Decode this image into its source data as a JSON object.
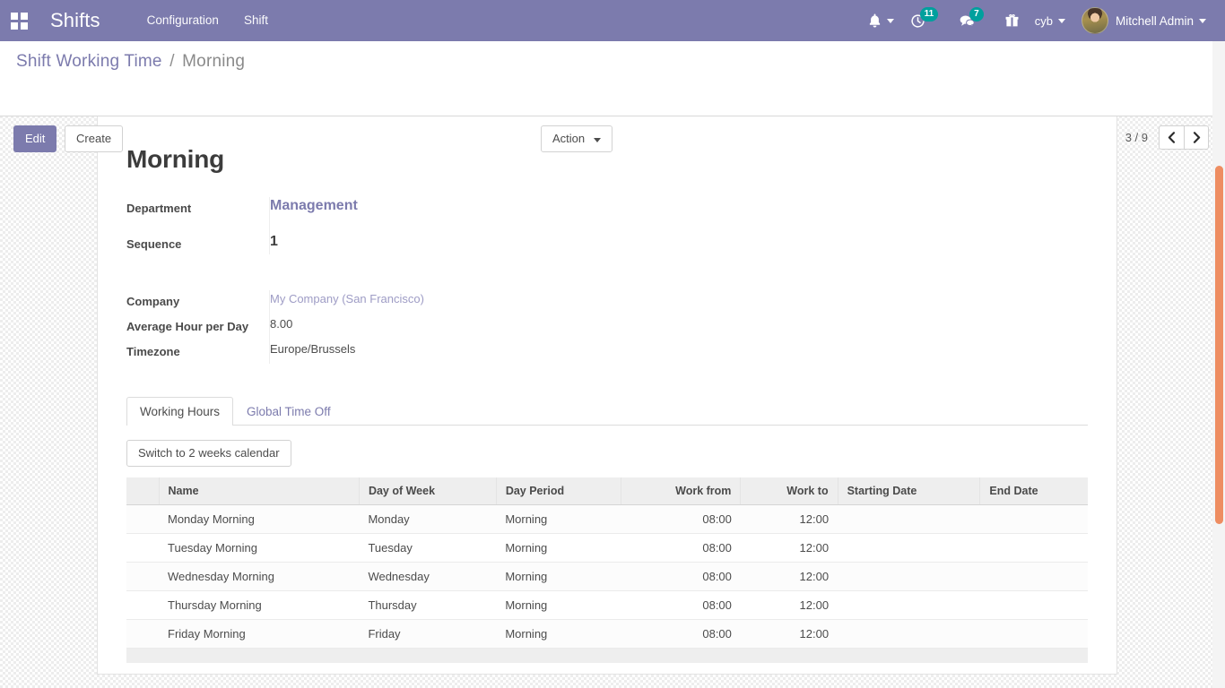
{
  "navbar": {
    "apps_icon": "apps-grid-icon",
    "brand": "Shifts",
    "menus": [
      {
        "label": "Configuration"
      },
      {
        "label": "Shift"
      }
    ],
    "activities_count": "11",
    "messages_count": "7",
    "database": "cyb",
    "user": "Mitchell Admin",
    "bg_color": "#7c7bad",
    "badge_color": "#00a09d"
  },
  "control_panel": {
    "breadcrumb_root": "Shift Working Time",
    "breadcrumb_separator": "/",
    "breadcrumb_current": "Morning",
    "edit_label": "Edit",
    "create_label": "Create",
    "action_label": "Action",
    "pager_text": "3 / 9",
    "pager_prev": "‹",
    "pager_next": "›"
  },
  "form": {
    "title": "Morning",
    "group_main": [
      {
        "label": "Department",
        "value": "Management",
        "kind": "link-strong"
      },
      {
        "label": "Sequence",
        "value": "1",
        "kind": "big"
      }
    ],
    "group_secondary": [
      {
        "label": "Company",
        "value": "My Company (San Francisco)",
        "kind": "link-soft"
      },
      {
        "label": "Average Hour per Day",
        "value": "8.00",
        "kind": "text"
      },
      {
        "label": "Timezone",
        "value": "Europe/Brussels",
        "kind": "text"
      }
    ]
  },
  "notebook": {
    "tabs": [
      {
        "label": "Working Hours",
        "active": true
      },
      {
        "label": "Global Time Off",
        "active": false
      }
    ],
    "switch_button": "Switch to 2 weeks calendar"
  },
  "working_hours_table": {
    "columns": [
      "Name",
      "Day of Week",
      "Day Period",
      "Work from",
      "Work to",
      "Starting Date",
      "End Date"
    ],
    "rows": [
      {
        "name": "Monday Morning",
        "day_of_week": "Monday",
        "day_period": "Morning",
        "work_from": "08:00",
        "work_to": "12:00",
        "starting_date": "",
        "end_date": ""
      },
      {
        "name": "Tuesday Morning",
        "day_of_week": "Tuesday",
        "day_period": "Morning",
        "work_from": "08:00",
        "work_to": "12:00",
        "starting_date": "",
        "end_date": ""
      },
      {
        "name": "Wednesday Morning",
        "day_of_week": "Wednesday",
        "day_period": "Morning",
        "work_from": "08:00",
        "work_to": "12:00",
        "starting_date": "",
        "end_date": ""
      },
      {
        "name": "Thursday Morning",
        "day_of_week": "Thursday",
        "day_period": "Morning",
        "work_from": "08:00",
        "work_to": "12:00",
        "starting_date": "",
        "end_date": ""
      },
      {
        "name": "Friday Morning",
        "day_of_week": "Friday",
        "day_period": "Morning",
        "work_from": "08:00",
        "work_to": "12:00",
        "starting_date": "",
        "end_date": ""
      }
    ]
  }
}
